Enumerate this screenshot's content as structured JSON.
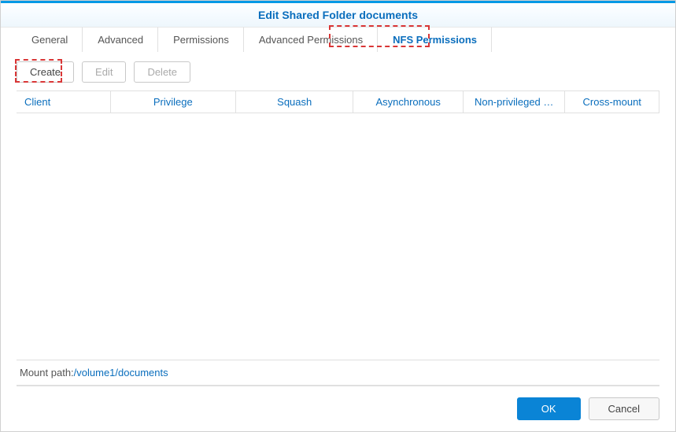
{
  "title": "Edit Shared Folder documents",
  "tabs": {
    "general": "General",
    "advanced": "Advanced",
    "permissions": "Permissions",
    "adv_permissions": "Advanced Permissions",
    "nfs_permissions": "NFS Permissions"
  },
  "toolbar": {
    "create": "Create",
    "edit": "Edit",
    "delete": "Delete"
  },
  "columns": {
    "client": "Client",
    "privilege": "Privilege",
    "squash": "Squash",
    "async": "Asynchronous",
    "nonpriv": "Non-privileged …",
    "cross": "Cross-mount"
  },
  "mount": {
    "label": "Mount path:",
    "path": "/volume1/documents"
  },
  "footer": {
    "ok": "OK",
    "cancel": "Cancel"
  }
}
